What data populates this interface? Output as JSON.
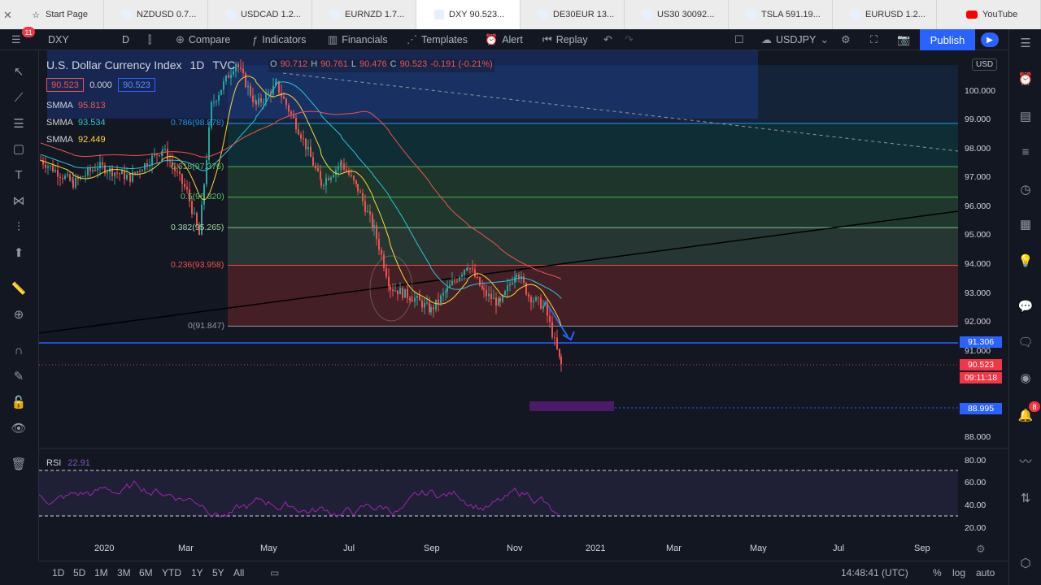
{
  "browser_tabs": [
    {
      "label": "Start Page",
      "icon": "star-icon"
    },
    {
      "label": "NZDUSD 0.7...",
      "icon": "tradingview-icon"
    },
    {
      "label": "USDCAD 1.2...",
      "icon": "tradingview-icon"
    },
    {
      "label": "EURNZD 1.7...",
      "icon": "tradingview-icon"
    },
    {
      "label": "DXY 90.523...",
      "icon": "tradingview-icon",
      "active": true
    },
    {
      "label": "DE30EUR 13...",
      "icon": "tradingview-icon"
    },
    {
      "label": "US30 30092...",
      "icon": "tradingview-icon"
    },
    {
      "label": "TSLA 591.19...",
      "icon": "tradingview-icon"
    },
    {
      "label": "EURUSD 1.2...",
      "icon": "tradingview-icon"
    },
    {
      "label": "YouTube",
      "icon": "youtube-icon"
    }
  ],
  "toolbar": {
    "notifications": "11",
    "symbol": "DXY",
    "interval": "D",
    "compare": "Compare",
    "indicators": "Indicators",
    "financials": "Financials",
    "templates": "Templates",
    "alert": "Alert",
    "replay": "Replay",
    "watch_symbol": "USDJPY",
    "publish": "Publish"
  },
  "legend": {
    "title": "U.S. Dollar Currency Index",
    "interval": "1D",
    "source": "TVC",
    "open": "90.712",
    "high": "90.761",
    "low": "90.476",
    "close": "90.523",
    "change": "-0.191 (-0.21%)",
    "bid": "90.523",
    "spread": "0.000",
    "ask": "90.523",
    "smma": [
      {
        "label": "SMMA",
        "value": "95.813",
        "color": "#ef5350"
      },
      {
        "label": "SMMA",
        "value": "93.534",
        "color": "#26c6da"
      },
      {
        "label": "SMMA",
        "value": "92.449",
        "color": "#fdd835"
      }
    ]
  },
  "fib_levels": [
    {
      "label": "0.786(98.878)",
      "value": 98.878,
      "color": "#2196f3"
    },
    {
      "label": "0.618(97.376)",
      "value": 97.376,
      "color": "#4caf50"
    },
    {
      "label": "0.5(96.320)",
      "value": 96.32,
      "color": "#4caf50"
    },
    {
      "label": "0.382(95.265)",
      "value": 95.265,
      "color": "#81c784"
    },
    {
      "label": "0.236(93.958)",
      "value": 93.958,
      "color": "#f44336"
    },
    {
      "label": "0(91.847)",
      "value": 91.847,
      "color": "#9598a1"
    }
  ],
  "price_axis": {
    "currency": "USD",
    "ticks": [
      "100.000",
      "99.000",
      "98.000",
      "97.000",
      "96.000",
      "95.000",
      "94.000",
      "93.000",
      "92.000",
      "91.000",
      "88.000"
    ],
    "line_level": "91.306",
    "last_price": "90.523",
    "countdown": "09:11:18",
    "target_level": "88.995",
    "rsi_ticks": [
      "80.00",
      "60.00",
      "40.00",
      "20.00"
    ]
  },
  "time_axis": [
    "2020",
    "Mar",
    "May",
    "Jul",
    "Sep",
    "Nov",
    "2021",
    "Mar",
    "May",
    "Jul",
    "Sep"
  ],
  "rsi": {
    "label": "RSI",
    "value": "22.91"
  },
  "bottom": {
    "timeframes": [
      "1D",
      "5D",
      "1M",
      "3M",
      "6M",
      "YTD",
      "1Y",
      "5Y",
      "All"
    ],
    "clock": "14:48:41 (UTC)",
    "percent": "%",
    "log": "log",
    "auto": "auto"
  },
  "right_badge": "8"
}
